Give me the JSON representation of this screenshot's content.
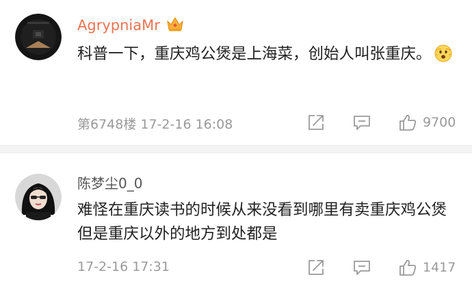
{
  "comments": [
    {
      "username": "AgrypniaMr",
      "username_color": "#eb7350",
      "badge_icon": "crown-icon",
      "text": "科普一下，重庆鸡公煲是上海菜，创始人叫张重庆。",
      "emoji": "scared-face-emoji",
      "meta": "第6748楼  17-2-16 16:08",
      "like_count": "9700"
    },
    {
      "username": "陈梦尘0_0",
      "username_color": "#555555",
      "text": "难怪在重庆读书的时候从来没看到哪里有卖重庆鸡公煲 但是重庆以外的地方到处都是",
      "meta": "17-2-16 17:31",
      "like_count": "1417"
    }
  ],
  "icons": {
    "share": "share-icon",
    "comment": "comment-icon",
    "like": "like-icon"
  }
}
